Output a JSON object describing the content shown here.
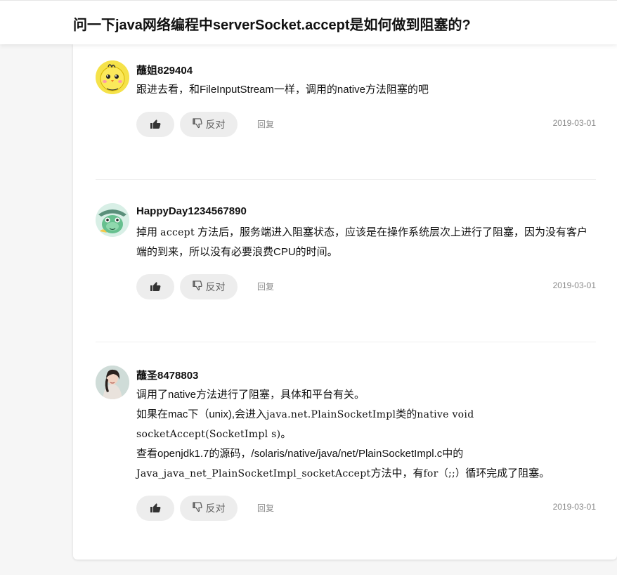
{
  "question": {
    "title": "问一下java网络编程中serverSocket.accept是如何做到阻塞的?"
  },
  "labels": {
    "oppose": "反对",
    "reply": "回复"
  },
  "answers": [
    {
      "author": "蘸姐829404",
      "avatar": "yellow-chick-avatar",
      "content": [
        [
          {
            "t": "跟进去看，和FileInputStream一样，调用的native方法阻塞的吧",
            "mono": false
          }
        ]
      ],
      "date": "2019-03-01"
    },
    {
      "author": "HappyDay1234567890",
      "avatar": "green-character-avatar",
      "content": [
        [
          {
            "t": "掉用 ",
            "mono": false
          },
          {
            "t": "accept",
            "mono": true
          },
          {
            "t": " 方法后，服务端进入阻塞状态，应该是在操作系统层次上进行了阻塞，因为没有客户端的到来，所以没有必要浪费CPU的时间。",
            "mono": false
          }
        ]
      ],
      "date": "2019-03-01"
    },
    {
      "author": "蘸圣8478803",
      "avatar": "person-photo-avatar",
      "content": [
        [
          {
            "t": "调用了native方法进行了阻塞，具体和平台有关。",
            "mono": false
          }
        ],
        [
          {
            "t": "如果在mac下（unix),会进入",
            "mono": false
          },
          {
            "t": "java.net.PlainSocketImpl",
            "mono": true
          },
          {
            "t": "类的",
            "mono": false
          },
          {
            "t": "native void socketAccept(SocketImpl s)",
            "mono": true
          },
          {
            "t": "。",
            "mono": false
          }
        ],
        [
          {
            "t": "查看openjdk1.7的源码，/solaris/native/java/net/PlainSocketImpl.c中的",
            "mono": false
          },
          {
            "t": "Java_java_net_PlainSocketImpl_socketAccept",
            "mono": true
          },
          {
            "t": "方法中，有",
            "mono": false
          },
          {
            "t": "for（;;）",
            "mono": true
          },
          {
            "t": "循环完成了阻塞。",
            "mono": false
          }
        ]
      ],
      "date": "2019-03-01"
    }
  ],
  "colors": {
    "page_bg": "#f6f6f6",
    "button_bg": "#ededed",
    "muted_text": "#8a8a8a"
  }
}
